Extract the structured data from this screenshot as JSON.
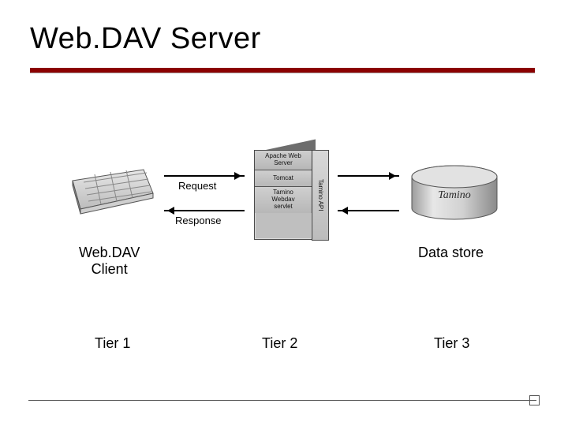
{
  "title": "Web.DAV Server",
  "arrows": {
    "request_label": "Request",
    "response_label": "Response"
  },
  "client_caption_1": "Web.DAV",
  "client_caption_2": "Client",
  "datastore_caption": "Data store",
  "datastore_logo": "Tamino",
  "server_stack": {
    "box1_line1": "Apache Web",
    "box1_line2": "Server",
    "box2": "Tomcat",
    "box3_line1": "Tamino",
    "box3_line2": "Webdav",
    "box3_line3": "servlet",
    "api_label": "Tamino API"
  },
  "tiers": {
    "t1": "Tier 1",
    "t2": "Tier 2",
    "t3": "Tier 3"
  }
}
